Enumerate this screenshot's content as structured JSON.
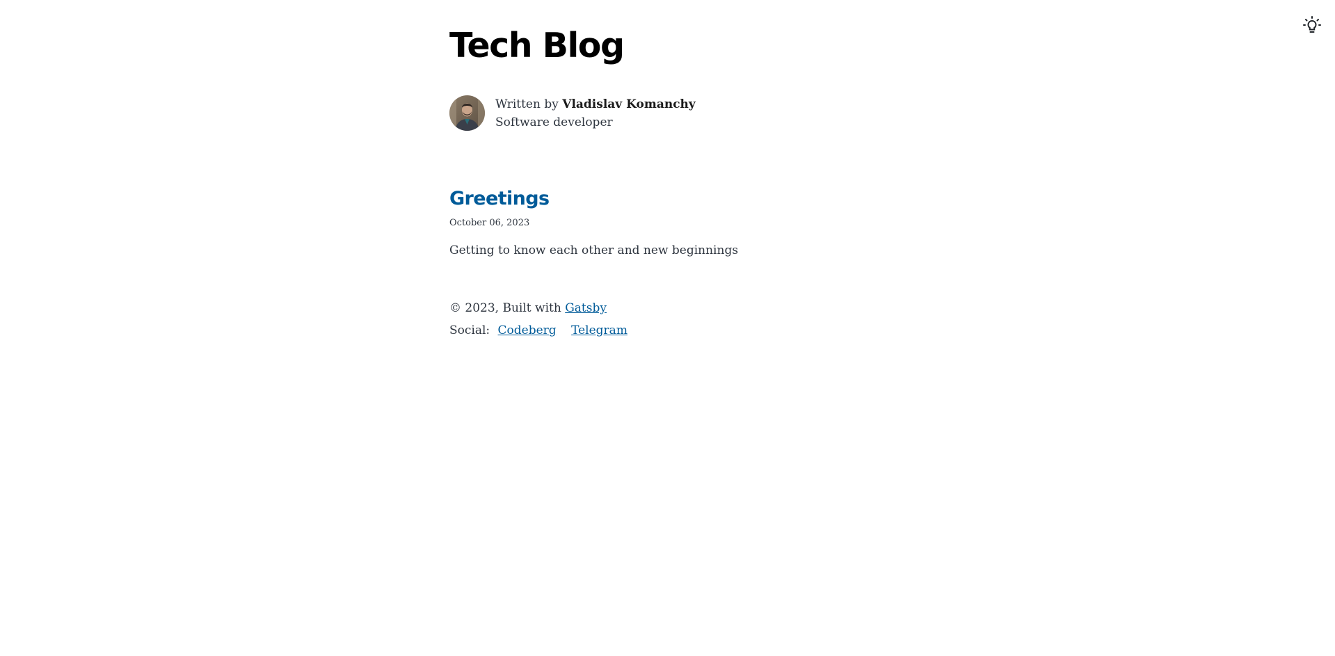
{
  "header": {
    "site_title": "Tech Blog",
    "theme_toggle_icon": "lightbulb-icon"
  },
  "bio": {
    "written_by_prefix": "Written by ",
    "author_name": "Vladislav Komanchy",
    "author_role": "Software developer",
    "avatar_icon": "author-avatar"
  },
  "posts": [
    {
      "title": "Greetings",
      "date": "October 06, 2023",
      "description": "Getting to know each other and new beginnings"
    }
  ],
  "footer": {
    "copyright_prefix": "© 2023, Built with ",
    "built_with_link": "Gatsby",
    "social_label": "Social: ",
    "social_links": [
      "Codeberg",
      "Telegram"
    ]
  },
  "colors": {
    "link": "#005b99",
    "text": "#2e353f",
    "title": "#000000"
  }
}
